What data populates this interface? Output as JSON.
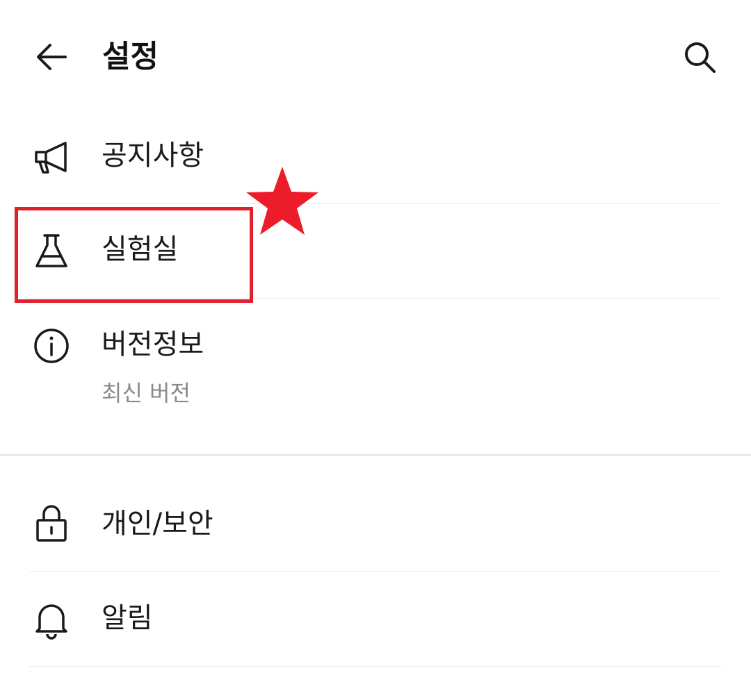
{
  "header": {
    "title": "설정",
    "back_icon": "arrow-left-icon",
    "search_icon": "search-icon"
  },
  "items": [
    {
      "label": "공지사항",
      "icon": "megaphone-icon"
    },
    {
      "label": "실험실",
      "icon": "flask-icon"
    },
    {
      "label": "버전정보",
      "sublabel": "최신 버전",
      "icon": "info-icon"
    },
    {
      "label": "개인/보안",
      "icon": "lock-icon"
    },
    {
      "label": "알림",
      "icon": "bell-icon"
    }
  ],
  "annotation": {
    "highlight_color": "#e0202c",
    "marker_icon": "star-icon"
  }
}
